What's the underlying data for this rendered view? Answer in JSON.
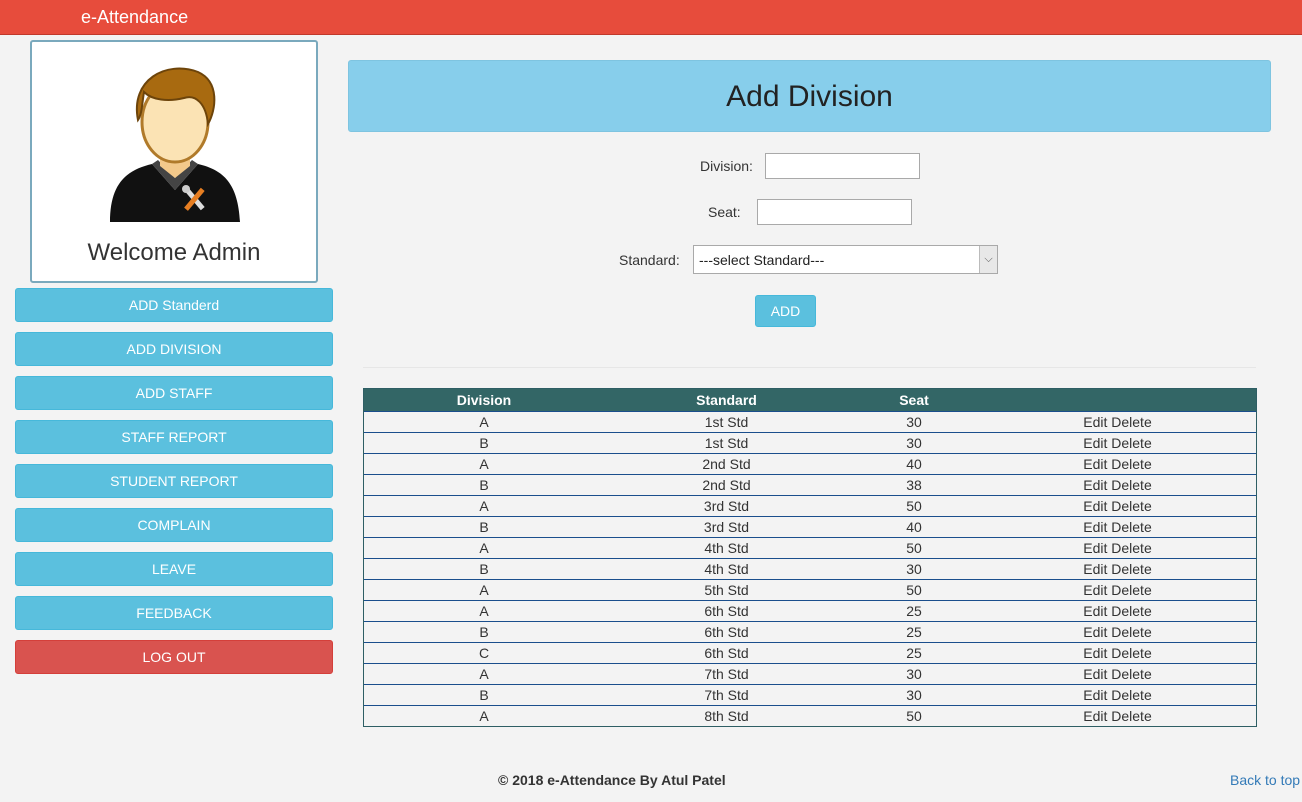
{
  "app": {
    "brand": "e-Attendance"
  },
  "profile": {
    "welcome": "Welcome Admin",
    "avatar_icon": "admin-avatar-icon"
  },
  "sidebar": {
    "items": [
      {
        "label": "ADD Standerd"
      },
      {
        "label": "ADD DIVISION"
      },
      {
        "label": "ADD STAFF"
      },
      {
        "label": "STAFF REPORT"
      },
      {
        "label": "STUDENT REPORT"
      },
      {
        "label": "COMPLAIN"
      },
      {
        "label": "LEAVE"
      },
      {
        "label": "FEEDBACK"
      }
    ],
    "logout": "LOG OUT"
  },
  "page": {
    "title": "Add Division"
  },
  "form": {
    "division_label": "Division:",
    "division_value": "",
    "seat_label": "Seat:",
    "seat_value": "",
    "standard_label": "Standard:",
    "standard_selected": "---select Standard---",
    "add_button": "ADD"
  },
  "table": {
    "headers": [
      "Division",
      "Standard",
      "Seat",
      ""
    ],
    "rows": [
      {
        "division": "A",
        "standard": "1st Std",
        "seat": "30",
        "edit": "Edit",
        "delete": "Delete"
      },
      {
        "division": "B",
        "standard": "1st Std",
        "seat": "30",
        "edit": "Edit",
        "delete": "Delete"
      },
      {
        "division": "A",
        "standard": "2nd Std",
        "seat": "40",
        "edit": "Edit",
        "delete": "Delete"
      },
      {
        "division": "B",
        "standard": "2nd Std",
        "seat": "38",
        "edit": "Edit",
        "delete": "Delete"
      },
      {
        "division": "A",
        "standard": "3rd Std",
        "seat": "50",
        "edit": "Edit",
        "delete": "Delete"
      },
      {
        "division": "B",
        "standard": "3rd Std",
        "seat": "40",
        "edit": "Edit",
        "delete": "Delete"
      },
      {
        "division": "A",
        "standard": "4th Std",
        "seat": "50",
        "edit": "Edit",
        "delete": "Delete"
      },
      {
        "division": "B",
        "standard": "4th Std",
        "seat": "30",
        "edit": "Edit",
        "delete": "Delete"
      },
      {
        "division": "A",
        "standard": "5th Std",
        "seat": "50",
        "edit": "Edit",
        "delete": "Delete"
      },
      {
        "division": "A",
        "standard": "6th Std",
        "seat": "25",
        "edit": "Edit",
        "delete": "Delete"
      },
      {
        "division": "B",
        "standard": "6th Std",
        "seat": "25",
        "edit": "Edit",
        "delete": "Delete"
      },
      {
        "division": "C",
        "standard": "6th Std",
        "seat": "25",
        "edit": "Edit",
        "delete": "Delete"
      },
      {
        "division": "A",
        "standard": "7th Std",
        "seat": "30",
        "edit": "Edit",
        "delete": "Delete"
      },
      {
        "division": "B",
        "standard": "7th Std",
        "seat": "30",
        "edit": "Edit",
        "delete": "Delete"
      },
      {
        "division": "A",
        "standard": "8th Std",
        "seat": "50",
        "edit": "Edit",
        "delete": "Delete"
      }
    ]
  },
  "footer": {
    "copyright": "© 2018 e-Attendance By Atul Patel",
    "back_to_top": "Back to top"
  },
  "colors": {
    "topbar": "#e74c3c",
    "header_panel": "#87ceeb",
    "nav_button": "#5bc0de",
    "logout_button": "#d9534f",
    "table_header": "#336666"
  }
}
